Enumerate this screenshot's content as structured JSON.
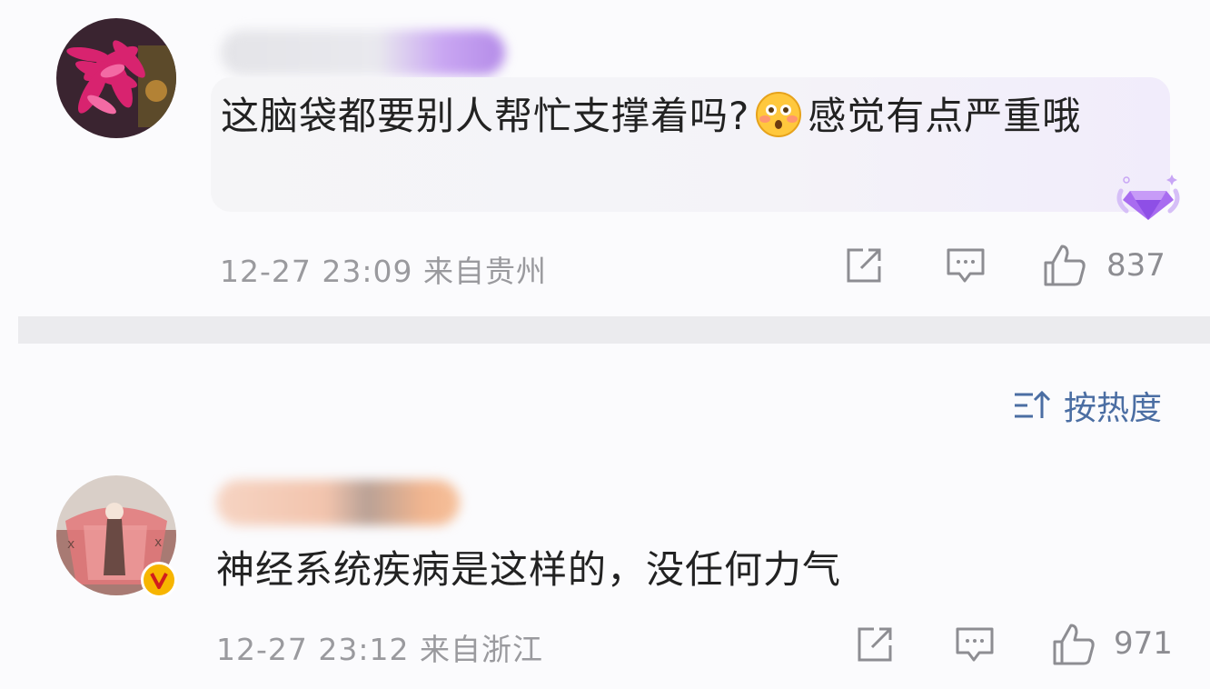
{
  "comments": [
    {
      "text_before_emoji": "这脑袋都要别人帮忙支撑着吗?",
      "emoji": "flushed-face-emoji",
      "text_after_emoji": "感觉有点严重哦",
      "meta": "12-27 23:09 来自贵州",
      "like_count": "837"
    },
    {
      "text": "神经系统疾病是这样的，没任何力气",
      "meta": "12-27 23:12 来自浙江",
      "like_count": "971"
    }
  ],
  "sort": {
    "label": "按热度"
  },
  "colors": {
    "meta_gray": "#9a9a9e",
    "sort_blue": "#4b6ea3",
    "divider": "#ebebee",
    "badge_purple": "#a86cf0",
    "verified_yellow": "#f7b500"
  }
}
